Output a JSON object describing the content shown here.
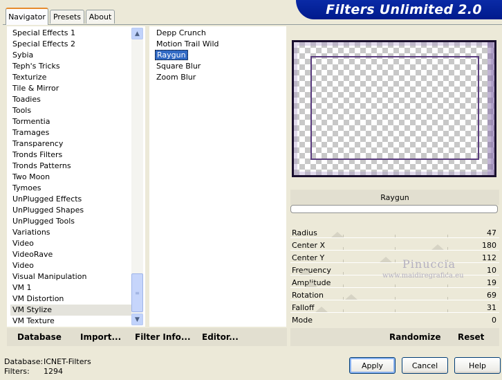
{
  "tabs": {
    "navigator": "Navigator",
    "presets": "Presets",
    "about": "About"
  },
  "title": "Filters Unlimited 2.0",
  "categories": [
    "Special Effects 1",
    "Special Effects 2",
    "Sybia",
    "Teph's Tricks",
    "Texturize",
    "Tile & Mirror",
    "Toadies",
    "Tools",
    "Tormentia",
    "Tramages",
    "Transparency",
    "Tronds Filters",
    "Tronds Patterns",
    "Two Moon",
    "Tymoes",
    "UnPlugged Effects",
    "UnPlugged Shapes",
    "UnPlugged Tools",
    "Variations",
    "Video",
    "VideoRave",
    "Video",
    "Visual Manipulation",
    "VM 1",
    "VM Distortion",
    "VM Stylize",
    "VM Texture"
  ],
  "selected_category": "VM Stylize",
  "filters": [
    "Depp Crunch",
    "Motion Trail Wild",
    "Raygun",
    "Square Blur",
    "Zoom Blur"
  ],
  "selected_filter": "Raygun",
  "preview_filter_name": "Raygun",
  "params": [
    {
      "label": "Radius",
      "value": "47",
      "thumb": 0.2
    },
    {
      "label": "Center X",
      "value": "180",
      "thumb": 0.7
    },
    {
      "label": "Center Y",
      "value": "112",
      "thumb": 0.44
    },
    {
      "label": "Frequency",
      "value": "10",
      "thumb": 0.04
    },
    {
      "label": "Amplitude",
      "value": "19",
      "thumb": 0.07
    },
    {
      "label": "Rotation",
      "value": "69",
      "thumb": 0.27
    },
    {
      "label": "Falloff",
      "value": "31",
      "thumb": 0.12
    },
    {
      "label": "Mode",
      "value": "0",
      "thumb": 0.0
    }
  ],
  "left_toolbar": {
    "database": "Database",
    "import": "Import...",
    "filter_info": "Filter Info...",
    "editor": "Editor..."
  },
  "right_toolbar": {
    "randomize": "Randomize",
    "reset": "Reset"
  },
  "status": {
    "database_label": "Database:",
    "database_value": "ICNET-Filters",
    "filters_label": "Filters:",
    "filters_value": "1294"
  },
  "buttons": {
    "apply": "Apply",
    "cancel": "Cancel",
    "help": "Help"
  },
  "watermark": {
    "name": "Pinuccia",
    "url": "www.maidiregrafica.eu"
  },
  "colors": {
    "selection": "#316ac5",
    "banner": "#001a8c",
    "tab_accent": "#e68b2c"
  }
}
